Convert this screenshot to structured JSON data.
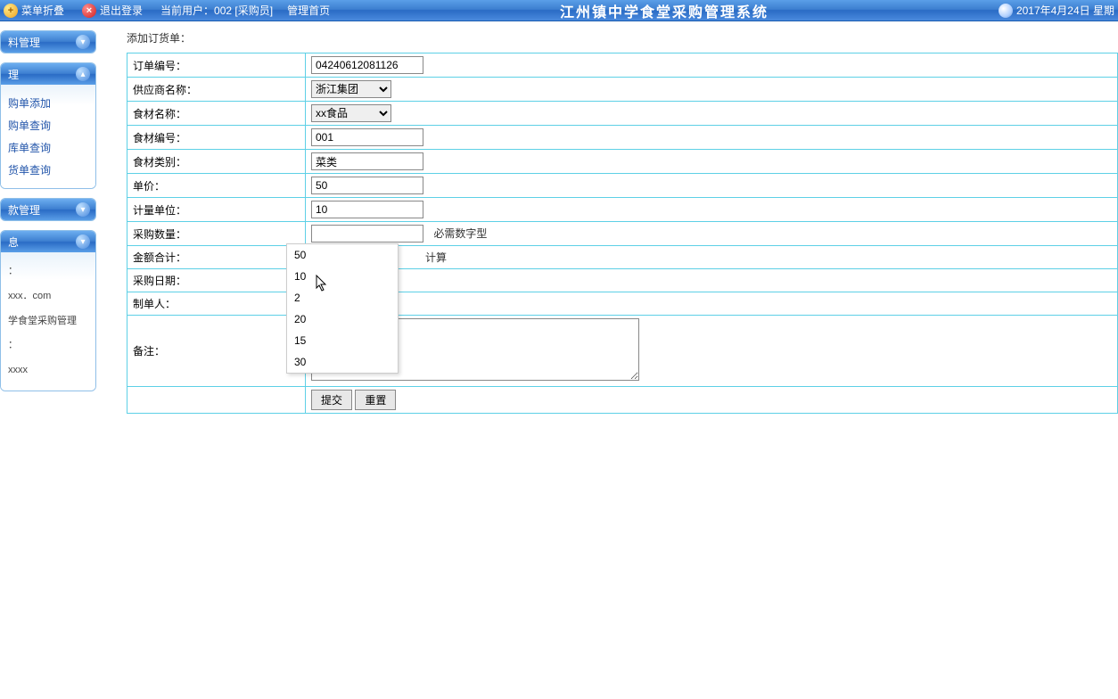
{
  "topbar": {
    "menu_toggle": "菜单折叠",
    "logout": "退出登录",
    "current_user_label": "当前用户：002 [采购员]",
    "admin_home": "管理首页",
    "system_title": "江州镇中学食堂采购管理系统",
    "date": "2017年4月24日 星期"
  },
  "sidebar": {
    "panels": [
      {
        "title": "料管理",
        "items": []
      },
      {
        "title": "理",
        "items": [
          "购单添加",
          "购单查询",
          "库单查询",
          "货单查询"
        ]
      },
      {
        "title": "款管理",
        "items": []
      },
      {
        "title": "息",
        "items": [
          "：",
          "xxx．com",
          "学食堂采购管理",
          "：",
          "xxxx"
        ]
      }
    ]
  },
  "page": {
    "title": "添加订货单："
  },
  "form": {
    "order_no": {
      "label": "订单编号：",
      "value": "04240612081126"
    },
    "supplier": {
      "label": "供应商名称：",
      "value": "浙江集团"
    },
    "food_name": {
      "label": "食材名称：",
      "value": "xx食品"
    },
    "food_no": {
      "label": "食材编号：",
      "value": "001"
    },
    "food_type": {
      "label": "食材类别：",
      "value": "菜类"
    },
    "unit_price": {
      "label": "单价：",
      "value": "50"
    },
    "unit": {
      "label": "计量单位：",
      "value": "10"
    },
    "qty": {
      "label": "采购数量：",
      "value": "",
      "hint": "必需数字型"
    },
    "total": {
      "label": "金额合计：",
      "hint": "计算"
    },
    "date": {
      "label": "采购日期："
    },
    "creator": {
      "label": "制单人："
    },
    "remark": {
      "label": "备注："
    },
    "submit": "提交",
    "reset": "重置"
  },
  "autocomplete": [
    "50",
    "10",
    "2",
    "20",
    "15",
    "30"
  ]
}
